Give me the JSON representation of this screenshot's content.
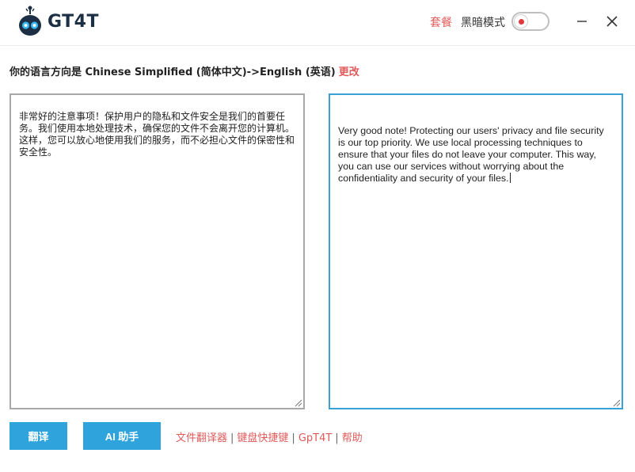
{
  "app": {
    "name": "GT4T"
  },
  "header": {
    "plan_link": "套餐",
    "dark_mode_label": "黑暗模式",
    "dark_mode_on": false
  },
  "direction": {
    "text": "你的语言方向是 Chinese Simplified (简体中文)->English (英语)",
    "change_label": "更改"
  },
  "source": {
    "text": "非常好的注意事项！保护用户的隐私和文件安全是我们的首要任务。我们使用本地处理技术，确保您的文件不会离开您的计算机。这样，您可以放心地使用我们的服务，而不必担心文件的保密性和安全性。"
  },
  "target": {
    "text": "Very good note! Protecting our users' privacy and file security is our top priority. We use local processing techniques to ensure that your files do not leave your computer. This way, you can use our services without worrying about the confidentiality and security of your files."
  },
  "buttons": {
    "translate": "翻译",
    "ai_assistant": "AI 助手"
  },
  "links": {
    "file_translator": "文件翻译器",
    "shortcuts": "键盘快捷键",
    "gpt4t": "GpT4T",
    "help": "帮助",
    "separator": "|"
  },
  "colors": {
    "accent_blue": "#2fa4dc",
    "link_red": "#e05a5a",
    "logo_navy": "#1d2f44"
  }
}
